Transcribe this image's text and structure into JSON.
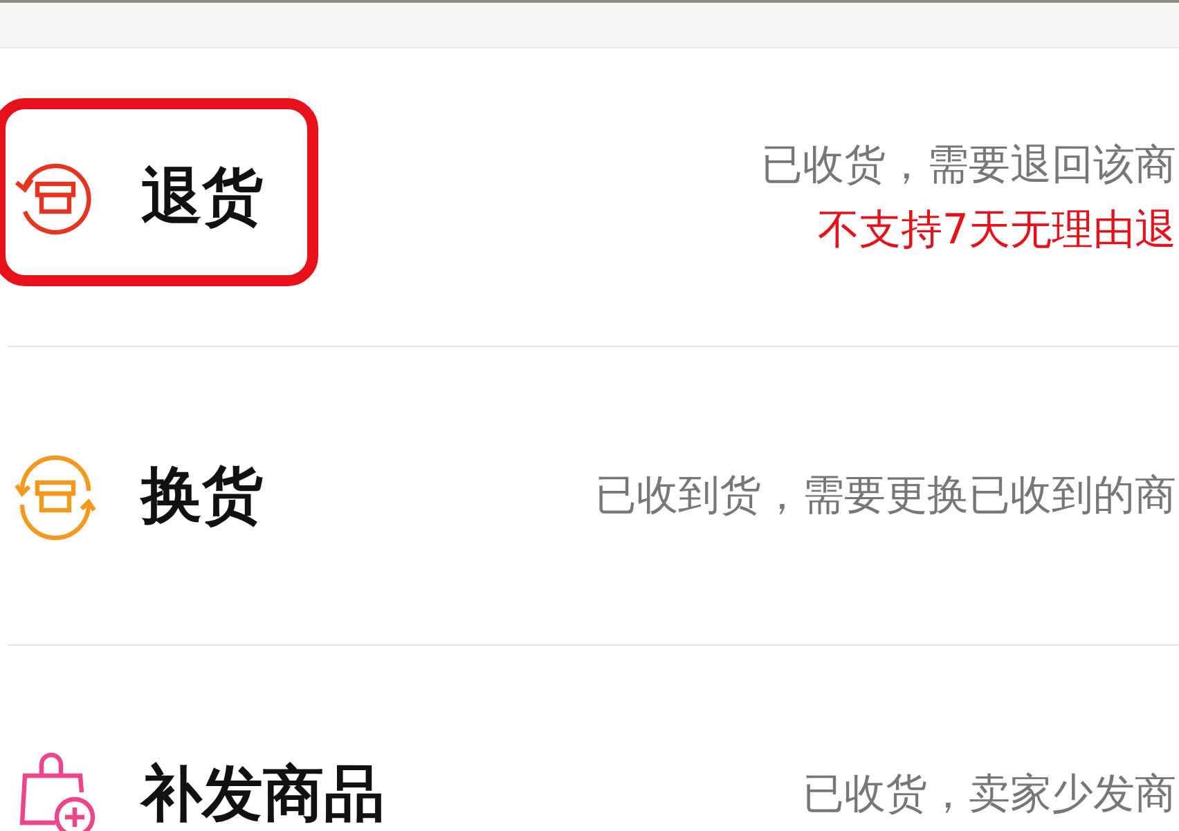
{
  "options": [
    {
      "kind": "return",
      "title": "退货",
      "highlighted": true,
      "description": "已收货，需要退回该商",
      "notice": "不支持7天无理由退"
    },
    {
      "kind": "exchange",
      "title": "换货",
      "highlighted": false,
      "description": "已收到货，需要更换已收到的商"
    },
    {
      "kind": "reissue",
      "title": "补发商品",
      "highlighted": false,
      "description": "已收货，卖家少发商"
    }
  ]
}
